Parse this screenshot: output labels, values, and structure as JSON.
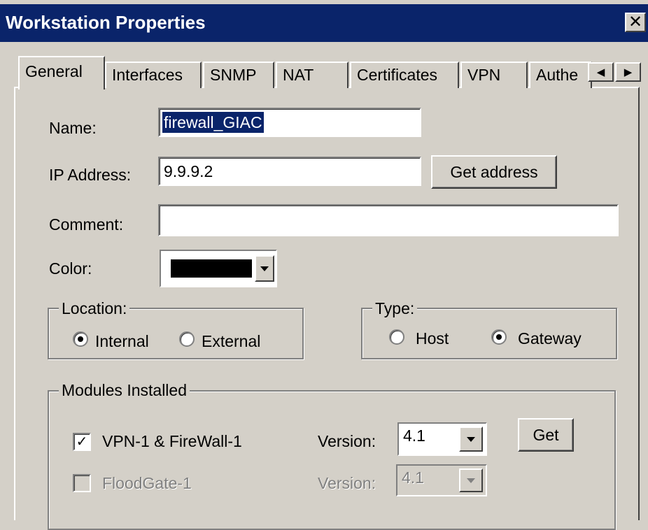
{
  "window": {
    "title": "Workstation Properties",
    "close_glyph": "✕"
  },
  "tabs": [
    {
      "label": "General",
      "selected": true
    },
    {
      "label": "Interfaces",
      "selected": false
    },
    {
      "label": "SNMP",
      "selected": false
    },
    {
      "label": "NAT",
      "selected": false
    },
    {
      "label": "Certificates",
      "selected": false
    },
    {
      "label": "VPN",
      "selected": false
    },
    {
      "label": "Authe",
      "selected": false
    }
  ],
  "tab_scroll": {
    "left_glyph": "◀",
    "right_glyph": "▶"
  },
  "form": {
    "name_label": "Name:",
    "name_value": "firewall_GIAC",
    "ip_label": "IP Address:",
    "ip_value": "9.9.9.2",
    "get_address_label": "Get address",
    "comment_label": "Comment:",
    "comment_value": "",
    "color_label": "Color:",
    "color_value": "#000000"
  },
  "location": {
    "legend": "Location:",
    "options": [
      {
        "label": "Internal",
        "checked": true
      },
      {
        "label": "External",
        "checked": false
      }
    ]
  },
  "type": {
    "legend": "Type:",
    "options": [
      {
        "label": "Host",
        "checked": false
      },
      {
        "label": "Gateway",
        "checked": true
      }
    ]
  },
  "modules": {
    "legend": "Modules Installed",
    "items": [
      {
        "label": "VPN-1 & FireWall-1",
        "checked": true,
        "enabled": true,
        "version_label": "Version:",
        "version": "4.1",
        "get_label": "Get"
      },
      {
        "label": "FloodGate-1",
        "checked": false,
        "enabled": false,
        "version_label": "Version:",
        "version": "4.1"
      }
    ]
  }
}
